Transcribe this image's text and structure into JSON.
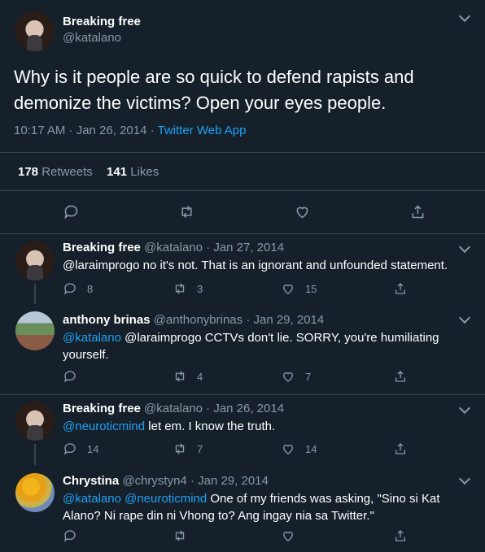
{
  "main_tweet": {
    "name": "Breaking free",
    "handle": "@katalano",
    "text": "Why is it people are so quick to defend rapists and demonize the victims? Open your eyes people.",
    "time": "10:17 AM · Jan 26, 2014 · ",
    "source": "Twitter Web App",
    "retweets": "178",
    "retweets_label": "Retweets",
    "likes": "141",
    "likes_label": "Likes"
  },
  "replies": [
    {
      "name": "Breaking free",
      "handle_date": "@katalano · Jan 27, 2014",
      "mention": "",
      "text": "@laraimprogo no it's not. That is an ignorant and unfounded statement.",
      "replies": "8",
      "retweets": "3",
      "likes": "15"
    },
    {
      "name": "anthony brinas",
      "handle_date": "@anthonybrinas · Jan 29, 2014",
      "mention": "@katalano",
      "text": " @laraimprogo CCTVs don't lie. SORRY, you're humiliating yourself.",
      "replies": "",
      "retweets": "4",
      "likes": "7"
    },
    {
      "name": "Breaking free",
      "handle_date": "@katalano · Jan 26, 2014",
      "mention": "@neuroticmind",
      "text": " let em. I know the truth.",
      "replies": "14",
      "retweets": "7",
      "likes": "14"
    },
    {
      "name": "Chrystina",
      "handle_date": "@chrystyn4 · Jan 29, 2014",
      "mention": "@katalano @neuroticmind",
      "text": " One of my friends was asking, \"Sino si Kat Alano? Ni rape din ni Vhong to? Ang ingay nia sa Twitter.\"",
      "replies": "",
      "retweets": "",
      "likes": ""
    }
  ]
}
